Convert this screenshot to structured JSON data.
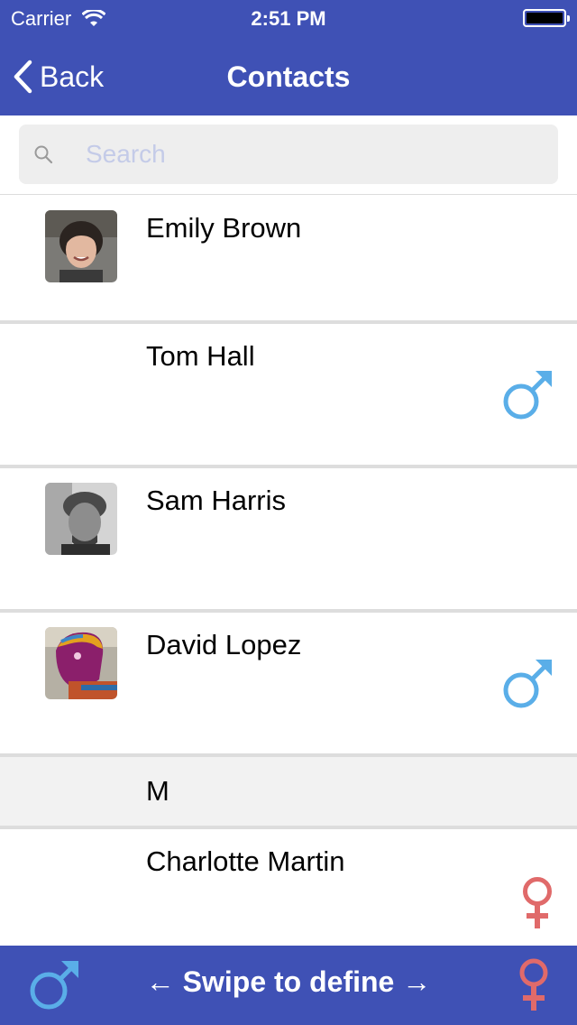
{
  "status_bar": {
    "carrier": "Carrier",
    "time": "2:51 PM"
  },
  "nav": {
    "back_label": "Back",
    "title": "Contacts"
  },
  "search": {
    "placeholder": "Search"
  },
  "contacts": [
    {
      "name": "Emily Brown",
      "has_photo": true,
      "gender": ""
    },
    {
      "name": "Tom Hall",
      "has_photo": false,
      "gender": "male"
    },
    {
      "name": "Sam Harris",
      "has_photo": true,
      "gender": ""
    },
    {
      "name": "David Lopez",
      "has_photo": true,
      "gender": "male"
    }
  ],
  "section": {
    "letter": "M"
  },
  "contacts_m": [
    {
      "name": "Charlotte Martin",
      "has_photo": false,
      "gender": "female"
    }
  ],
  "bottom_bar": {
    "hint": "← Swipe to define →"
  },
  "colors": {
    "accent": "#3f51b5",
    "male": "#5aaee8",
    "female": "#e06a6a",
    "separator": "#dddddd",
    "section_bg": "#f2f2f2"
  },
  "icons": {
    "male": "male-symbol-icon",
    "female": "female-symbol-icon"
  }
}
